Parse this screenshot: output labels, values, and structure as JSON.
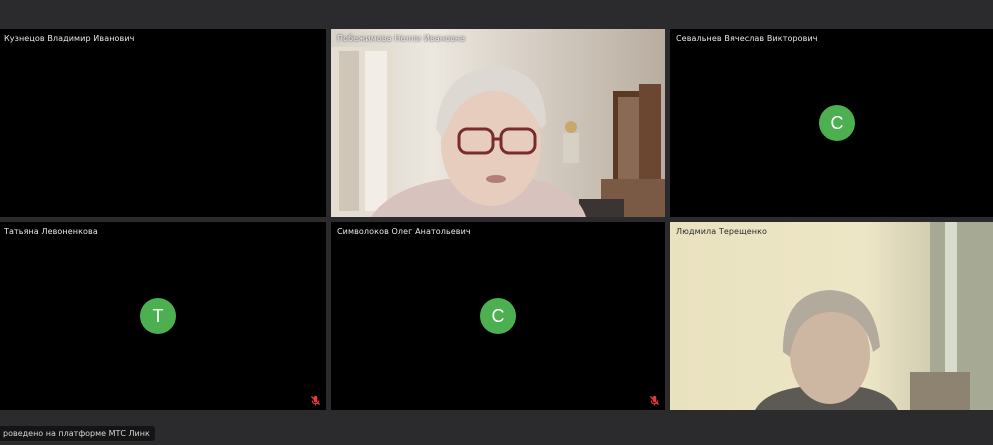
{
  "conference": {
    "footer_text": "роведено на платформе МТС Линк",
    "avatar_color": "#4caf50",
    "tile_color": "#000000",
    "background_color": "#2b2b2d"
  },
  "participants": [
    {
      "name": "Кузнецов Владимир Иванович",
      "avatar": "",
      "video": false,
      "muted": false
    },
    {
      "name": "Побежимова Нелли Ивановна",
      "avatar": "",
      "video": true,
      "muted": false
    },
    {
      "name": "Севальнев Вячеслав Викторович",
      "avatar": "С",
      "video": false,
      "muted": false
    },
    {
      "name": "Татьяна Левоненкова",
      "avatar": "Т",
      "video": false,
      "muted": true
    },
    {
      "name": "Символоков Олег Анатольевич",
      "avatar": "С",
      "video": false,
      "muted": true
    },
    {
      "name": "Людмила Терещенко",
      "avatar": "",
      "video": true,
      "muted": false
    }
  ],
  "icons": {
    "muted_mic": "mic-off-icon"
  }
}
